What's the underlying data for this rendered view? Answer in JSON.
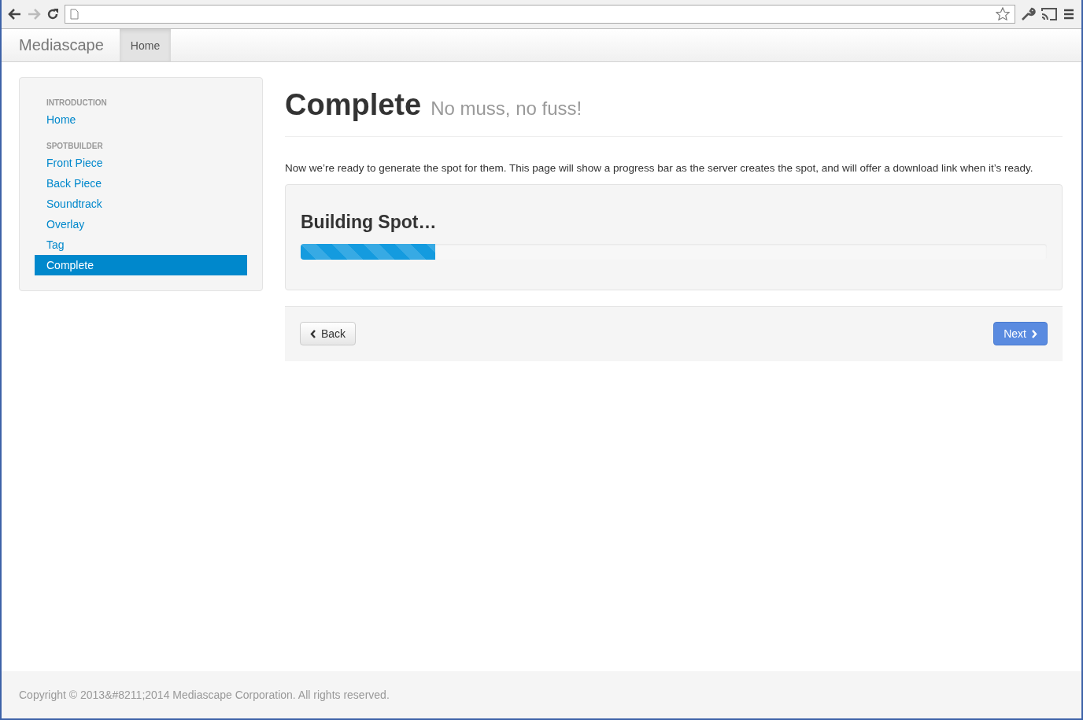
{
  "navbar": {
    "brand": "Mediascape",
    "tabs": [
      {
        "label": "Home",
        "selected": true
      }
    ]
  },
  "sidebar": {
    "sections": [
      {
        "heading": "INTRODUCTION",
        "items": [
          {
            "label": "Home",
            "selected": false
          }
        ]
      },
      {
        "heading": "SPOTBUILDER",
        "items": [
          {
            "label": "Front Piece",
            "selected": false
          },
          {
            "label": "Back Piece",
            "selected": false
          },
          {
            "label": "Soundtrack",
            "selected": false
          },
          {
            "label": "Overlay",
            "selected": false
          },
          {
            "label": "Tag",
            "selected": false
          },
          {
            "label": "Complete",
            "selected": true
          }
        ]
      }
    ]
  },
  "page": {
    "title": "Complete",
    "subtitle": "No muss, no fuss!",
    "intro": "Now we’re ready to generate the spot for them. This page will show a progress bar as the server creates the spot, and will offer a download link when it’s ready.",
    "progress": {
      "heading": "Building Spot…",
      "level": 0.18
    },
    "back_button": "Back",
    "next_button": "Next"
  },
  "footer": "Copyright © 2013&#8211;2014 Mediascape Corporation. All rights reserved."
}
